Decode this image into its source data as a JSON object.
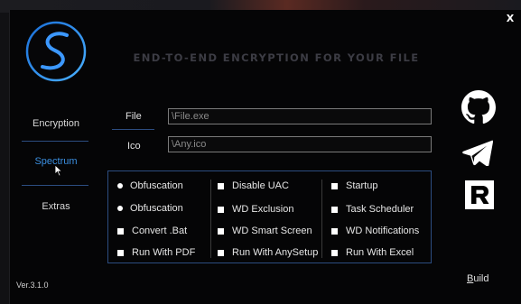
{
  "header": {
    "title": "END-TO-END ENCRYPTION FOR YOUR FILE",
    "close_label": "X"
  },
  "sidebar": {
    "items": [
      {
        "label": "Encryption",
        "active": false
      },
      {
        "label": "Spectrum",
        "active": true
      },
      {
        "label": "Extras",
        "active": false
      }
    ]
  },
  "fields": {
    "file": {
      "label": "File",
      "value": "\\File.exe"
    },
    "ico": {
      "label": "Ico",
      "value": "\\Any.ico"
    }
  },
  "options": {
    "col1": [
      {
        "label": "Obfuscation",
        "control": "radio"
      },
      {
        "label": "Obfuscation",
        "control": "radio"
      },
      {
        "label": "Convert .Bat",
        "control": "checkbox"
      },
      {
        "label": "Run With PDF",
        "control": "checkbox"
      }
    ],
    "col2": [
      {
        "label": "Disable UAC",
        "control": "checkbox"
      },
      {
        "label": "WD Exclusion",
        "control": "checkbox"
      },
      {
        "label": "WD Smart Screen",
        "control": "checkbox"
      },
      {
        "label": "Run With AnySetup",
        "control": "checkbox"
      }
    ],
    "col3": [
      {
        "label": "Startup",
        "control": "checkbox"
      },
      {
        "label": "Task Scheduler",
        "control": "checkbox"
      },
      {
        "label": "WD Notifications",
        "control": "checkbox"
      },
      {
        "label": "Run With Excel",
        "control": "checkbox"
      }
    ]
  },
  "social": {
    "icons": [
      "github-icon",
      "telegram-icon",
      "r-logo-icon"
    ]
  },
  "footer": {
    "version": "Ver.3.1.0",
    "build_label": "Build"
  },
  "colors": {
    "accent": "#3b8fe0",
    "separator": "#2c4d80",
    "background": "#050506"
  }
}
